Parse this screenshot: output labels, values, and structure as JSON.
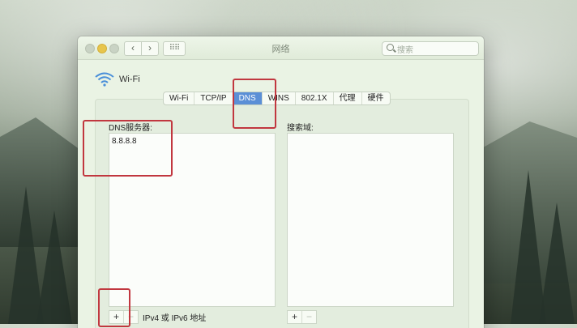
{
  "window": {
    "title": "网络",
    "search_placeholder": "搜索"
  },
  "interface": {
    "name": "Wi-Fi"
  },
  "tabs": [
    {
      "label": "Wi-Fi",
      "active": false
    },
    {
      "label": "TCP/IP",
      "active": false
    },
    {
      "label": "DNS",
      "active": true
    },
    {
      "label": "WINS",
      "active": false
    },
    {
      "label": "802.1X",
      "active": false
    },
    {
      "label": "代理",
      "active": false
    },
    {
      "label": "硬件",
      "active": false
    }
  ],
  "dns": {
    "label": "DNS服务器:",
    "servers": [
      "8.8.8.8"
    ],
    "hint": "IPv4 或 IPv6 地址"
  },
  "search_domains": {
    "label": "搜索域:"
  },
  "buttons": {
    "add": "+",
    "remove": "−"
  },
  "colors": {
    "accent": "#5b8fd6",
    "highlight_box": "#c1373f"
  }
}
